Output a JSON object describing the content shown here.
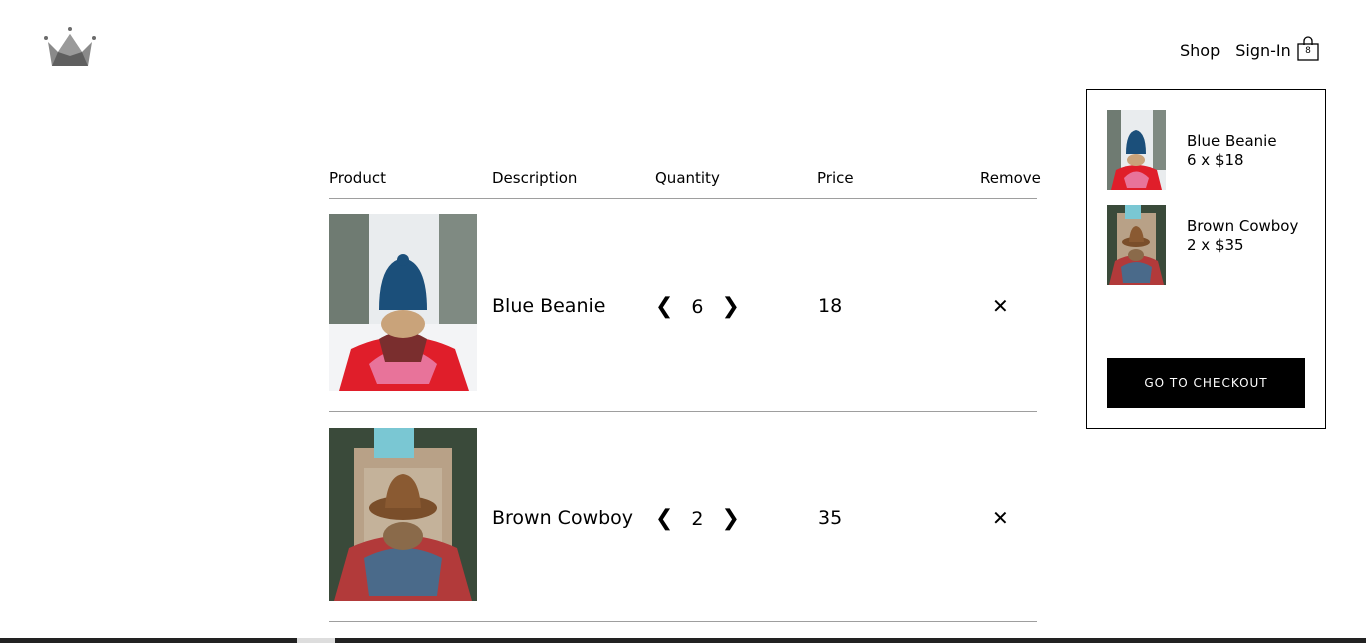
{
  "nav": {
    "shop": "Shop",
    "signin": "Sign-In",
    "cart_count": "8"
  },
  "table": {
    "headers": [
      "Product",
      "Description",
      "Quantity",
      "Price",
      "Remove"
    ],
    "rows": [
      {
        "name": "Blue Beanie",
        "quantity": "6",
        "price": "18",
        "dec": "❮",
        "inc": "❯",
        "remove": "✕"
      },
      {
        "name": "Brown Cowboy",
        "quantity": "2",
        "price": "35",
        "dec": "❮",
        "inc": "❯",
        "remove": "✕"
      }
    ]
  },
  "dropdown": {
    "items": [
      {
        "name": "Blue Beanie",
        "detail": "6 x $18"
      },
      {
        "name": "Brown Cowboy",
        "detail": "2 x $35"
      }
    ],
    "checkout_label": "GO TO CHECKOUT"
  }
}
